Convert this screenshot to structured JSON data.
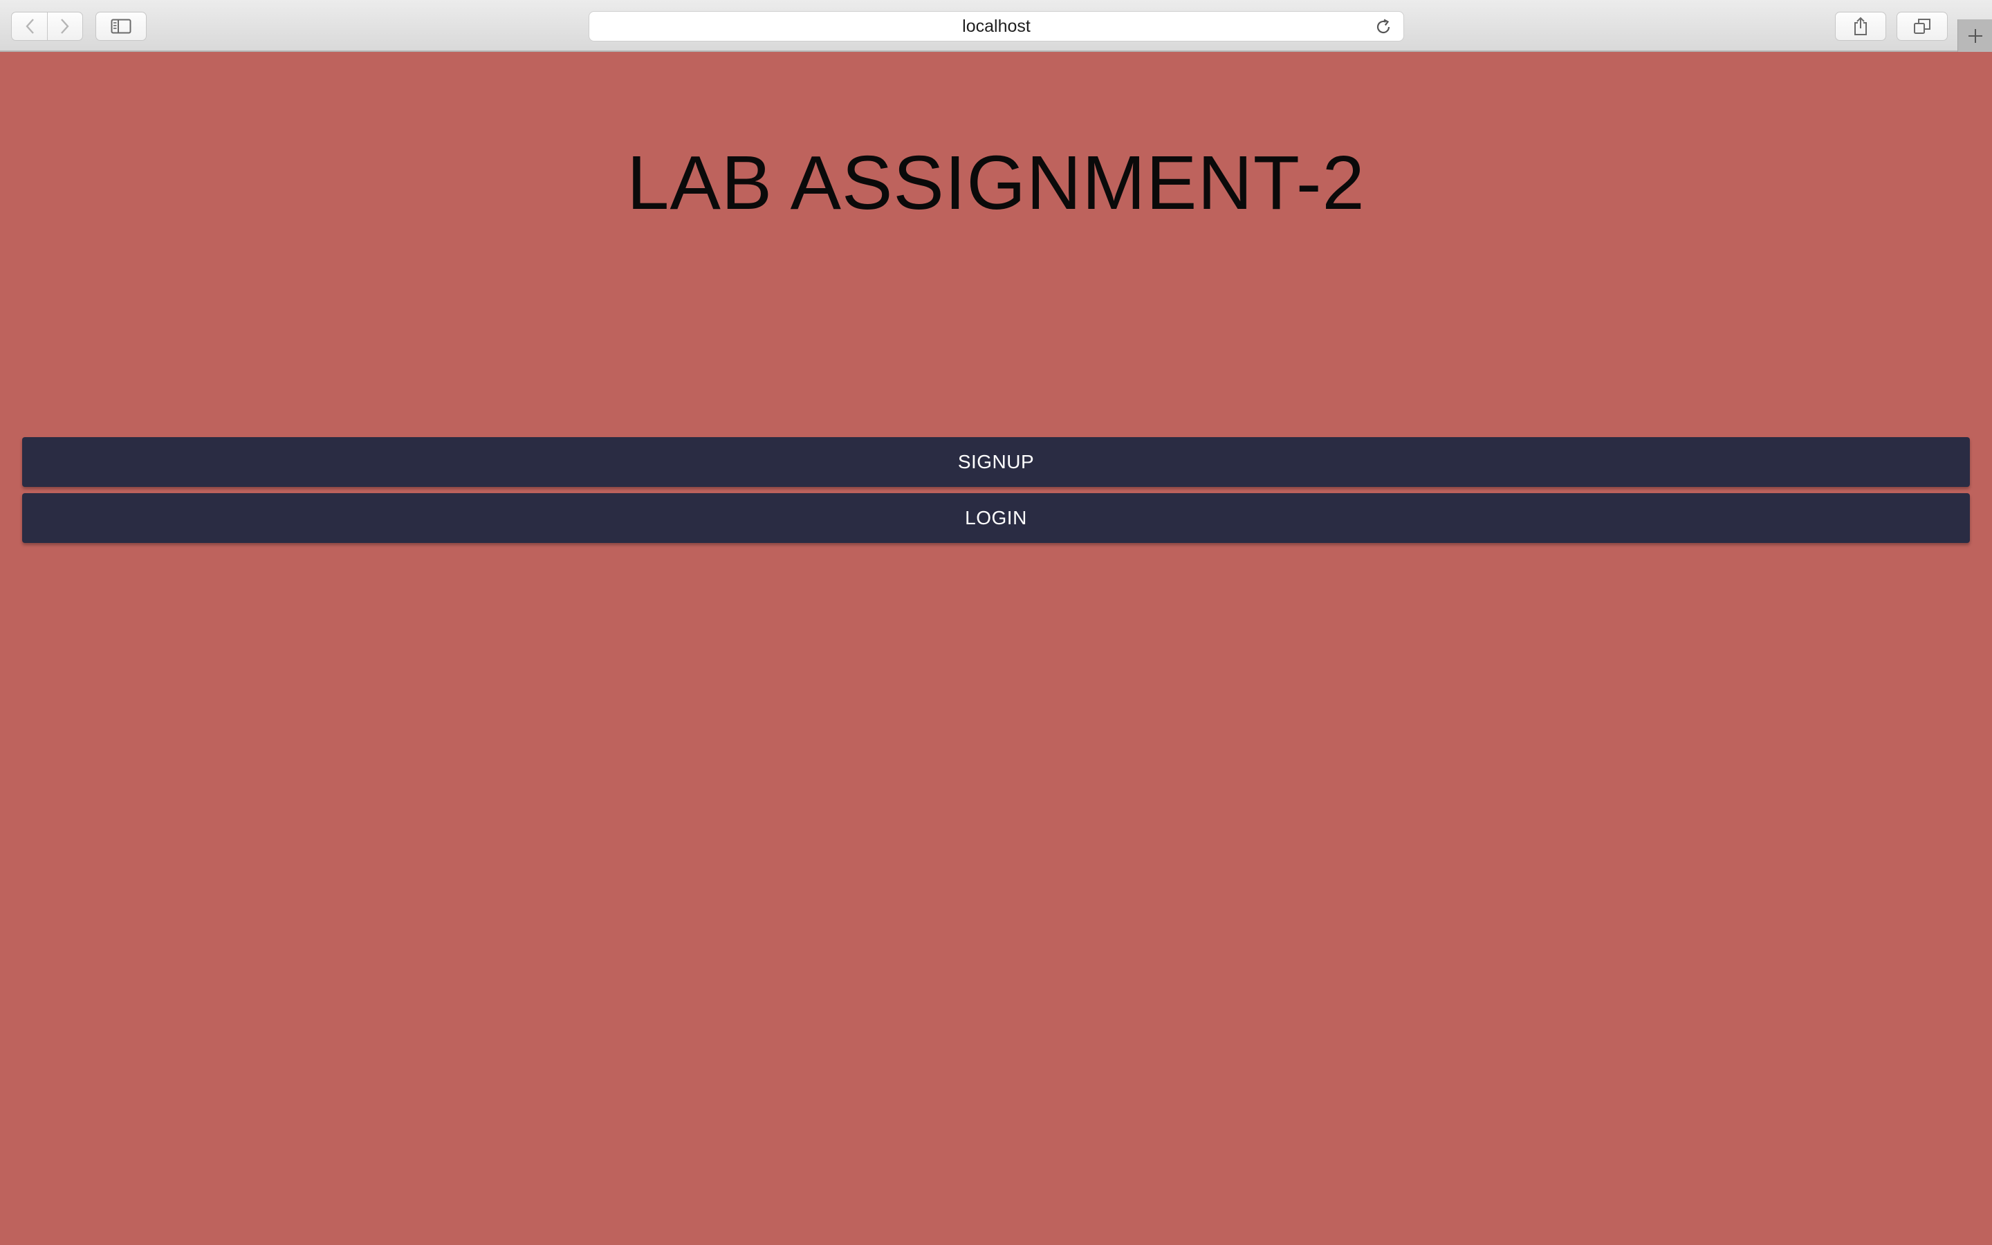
{
  "browser": {
    "address": "localhost",
    "icons": {
      "back": "chevron-left-icon",
      "forward": "chevron-right-icon",
      "sidebar": "sidebar-icon",
      "reload": "reload-icon",
      "share": "share-icon",
      "tabs": "tabs-overview-icon",
      "new_tab": "plus-icon"
    }
  },
  "page": {
    "title": "LAB ASSIGNMENT-2",
    "background_color": "#be635d",
    "button_color": "#2a2c43",
    "buttons": {
      "signup": "SIGNUP",
      "login": "LOGIN"
    }
  }
}
